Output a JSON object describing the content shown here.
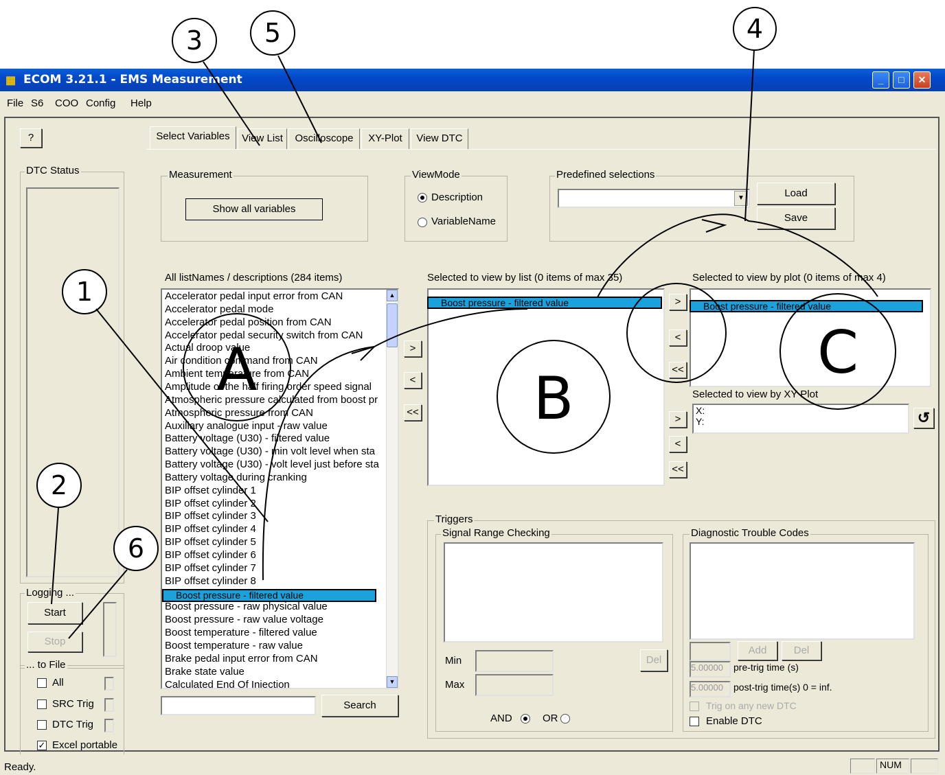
{
  "callouts": [
    "1",
    "2",
    "3",
    "4",
    "5",
    "6"
  ],
  "zones": [
    "A",
    "B",
    "C"
  ],
  "window": {
    "title": "ECOM 3.21.1 - EMS Measurement",
    "controls": [
      "minimize",
      "maximize",
      "close"
    ]
  },
  "menu": [
    "File",
    "S6",
    "COO",
    "Config",
    "Help"
  ],
  "help_button": "?",
  "tabs": [
    "Select Variables",
    "View List",
    "Oscilloscope",
    "XY-Plot",
    "View DTC"
  ],
  "left_panel": {
    "dtc_status_label": "DTC Status",
    "logging_label": "Logging ...",
    "start_label": "Start",
    "stop_label": "Stop",
    "to_file_label": "... to File",
    "checkboxes": [
      {
        "label": "All",
        "checked": false
      },
      {
        "label": "SRC Trig",
        "checked": false
      },
      {
        "label": "DTC Trig",
        "checked": false
      },
      {
        "label": "Excel portable",
        "checked": true
      }
    ]
  },
  "measurement": {
    "label": "Measurement",
    "button": "Show all variables"
  },
  "viewmode": {
    "label": "ViewMode",
    "options": [
      "Description",
      "VariableName"
    ],
    "selected": "Description"
  },
  "predefined": {
    "label": "Predefined selections",
    "value": "",
    "load": "Load",
    "save": "Save"
  },
  "all_list": {
    "header": "All listNames / descriptions (284 items)",
    "items": [
      "Accelerator pedal input error from CAN",
      "Accelerator pedal mode",
      "Accelerator pedal position from CAN",
      "Accelerator pedal security switch from CAN",
      "Actual droop value",
      "Air condition command from CAN",
      "Ambient temperature from CAN",
      "Amplitude of the half firing order speed signal",
      "Atmospheric pressure calculated from boost pr",
      "Atmospheric pressure from CAN",
      "Auxiliary analogue input - raw value",
      "Battery voltage (U30) - filtered value",
      "Battery voltage (U30) - min volt level when sta",
      "Battery voltage (U30) - volt level just before sta",
      "Battery voltage during cranking",
      "BIP offset cylinder 1",
      "BIP offset cylinder 2",
      "BIP offset cylinder 3",
      "BIP offset cylinder 4",
      "BIP offset cylinder 5",
      "BIP offset cylinder 6",
      "BIP offset cylinder 7",
      "BIP offset cylinder 8",
      "Boost pressure - filtered value",
      "Boost pressure - raw physical value",
      "Boost pressure - raw value voltage",
      "Boost temperature - filtered value",
      "Boost temperature - raw value",
      "Brake pedal input error from CAN",
      "Brake state value",
      "Calculated End Of Injection"
    ],
    "selected_index": 23,
    "search_value": "",
    "search_button": "Search"
  },
  "move_buttons": [
    ">",
    "<",
    "<<"
  ],
  "list_selection": {
    "header": "Selected to view by list (0 items of max 35)",
    "items": [
      "Boost pressure - filtered value"
    ]
  },
  "plot_selection": {
    "header": "Selected to view by plot (0 items of max 4)",
    "items": [
      "Boost pressure - filtered value"
    ]
  },
  "xy_selection": {
    "header": "Selected to view by XY Plot",
    "x_label": "X:",
    "y_label": "Y:",
    "swap_icon": "rotate-icon"
  },
  "triggers": {
    "label": "Triggers",
    "signal_range_label": "Signal Range Checking",
    "min_label": "Min",
    "max_label": "Max",
    "del_label": "Del",
    "and_label": "AND",
    "or_label": "OR",
    "logic_selected": "AND",
    "dtc_label": "Diagnostic Trouble Codes",
    "add_label": "Add",
    "dtc_del_label": "Del",
    "pre_trig_value": "5.00000",
    "pre_trig_label": "pre-trig time (s)",
    "post_trig_value": "5.00000",
    "post_trig_label": "post-trig time(s) 0 = inf.",
    "trig_any_label": "Trig on any new DTC",
    "enable_dtc_label": "Enable DTC"
  },
  "status": {
    "text": "Ready.",
    "num": "NUM"
  }
}
